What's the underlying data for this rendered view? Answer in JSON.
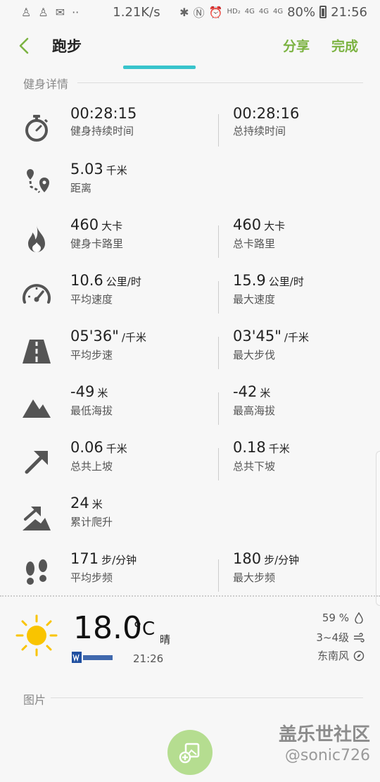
{
  "status_bar": {
    "net_speed": "1.21K/s",
    "hd": "HD₂",
    "net1": "4G",
    "net2": "4G",
    "net3": "4G",
    "battery": "80%",
    "time": "21:56"
  },
  "app_bar": {
    "title": "跑步",
    "share_label": "分享",
    "done_label": "完成"
  },
  "section_detail": "健身详情",
  "metrics": [
    {
      "icon": "stopwatch-icon",
      "a_value": "00:28:15",
      "a_unit": "",
      "a_label": "健身持续时间",
      "b_value": "00:28:16",
      "b_unit": "",
      "b_label": "总持续时间"
    },
    {
      "icon": "distance-icon",
      "a_value": "5.03",
      "a_unit": "千米",
      "a_label": "距离",
      "b_value": "",
      "b_unit": "",
      "b_label": ""
    },
    {
      "icon": "flame-icon",
      "a_value": "460",
      "a_unit": "大卡",
      "a_label": "健身卡路里",
      "b_value": "460",
      "b_unit": "大卡",
      "b_label": "总卡路里"
    },
    {
      "icon": "speedometer-icon",
      "a_value": "10.6",
      "a_unit": "公里/时",
      "a_label": "平均速度",
      "b_value": "15.9",
      "b_unit": "公里/时",
      "b_label": "最大速度"
    },
    {
      "icon": "road-icon",
      "a_value": "05'36\"",
      "a_unit": "/千米",
      "a_label": "平均步速",
      "b_value": "03'45\"",
      "b_unit": "/千米",
      "b_label": "最大步伐"
    },
    {
      "icon": "mountain-icon",
      "a_value": "-49",
      "a_unit": "米",
      "a_label": "最低海拔",
      "b_value": "-42",
      "b_unit": "米",
      "b_label": "最高海拔"
    },
    {
      "icon": "arrow-up-right-icon",
      "a_value": "0.06",
      "a_unit": "千米",
      "a_label": "总共上坡",
      "b_value": "0.18",
      "b_unit": "千米",
      "b_label": "总共下坡"
    },
    {
      "icon": "climb-icon",
      "a_value": "24",
      "a_unit": "米",
      "a_label": "累计爬升",
      "b_value": "",
      "b_unit": "",
      "b_label": ""
    },
    {
      "icon": "footprints-icon",
      "a_value": "171",
      "a_unit": "步/分钟",
      "a_label": "平均步频",
      "b_value": "180",
      "b_unit": "步/分钟",
      "b_label": "最大步频"
    }
  ],
  "weather": {
    "temperature": "18.0",
    "unit": "°C",
    "condition": "晴",
    "time": "21:26",
    "humidity": "59 %",
    "wind_level": "3~4级",
    "wind_dir": "东南风"
  },
  "section_pictures": "图片",
  "watermark": {
    "line1": "盖乐世社区",
    "line2": "@sonic726"
  },
  "colors": {
    "accent_green": "#7cb342",
    "tab_indicator": "#38c4cc",
    "icon_gray": "#555555",
    "sun": "#f9c400"
  }
}
